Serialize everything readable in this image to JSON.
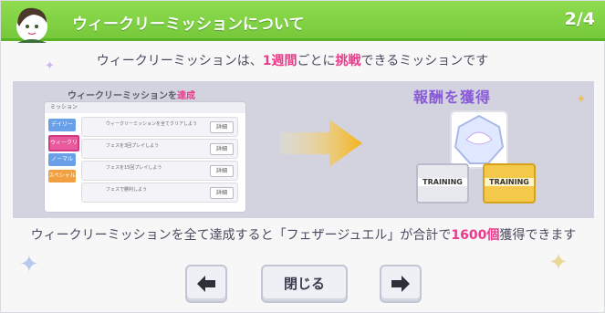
{
  "header": {
    "title": "ウィークリーミッションについて",
    "page": "2/4"
  },
  "description": {
    "pre": "ウィークリーミッションは、",
    "hl1": "1週間",
    "mid": "ごとに",
    "hl2": "挑戦",
    "post": "できるミッションです"
  },
  "illustration": {
    "subtitle_pre": "ウィークリーミッションを",
    "subtitle_hl": "達成",
    "mini_header": "ミッション",
    "tabs": [
      "デイリー",
      "ウィークリー",
      "ノーマル",
      "スペシャル"
    ],
    "rows": [
      "ウィークリーミッションを全てクリアしよう",
      "フェスを3回プレイしよう",
      "フェスを15回プレイしよう",
      "フェスで勝利しよう"
    ],
    "row_button": "詳細",
    "reward_label": "報酬を獲得",
    "ticket_left": "TRAINING",
    "ticket_right": "TRAINING"
  },
  "bottom": {
    "pre": "ウィークリーミッションを全て達成すると「フェザージュエル」が合計で",
    "hl": "1600個",
    "post": "獲得できます"
  },
  "buttons": {
    "close": "閉じる"
  },
  "colors": {
    "header": "#76c93b",
    "highlight": "#e83c8b",
    "reward": "#8a5bd6"
  }
}
